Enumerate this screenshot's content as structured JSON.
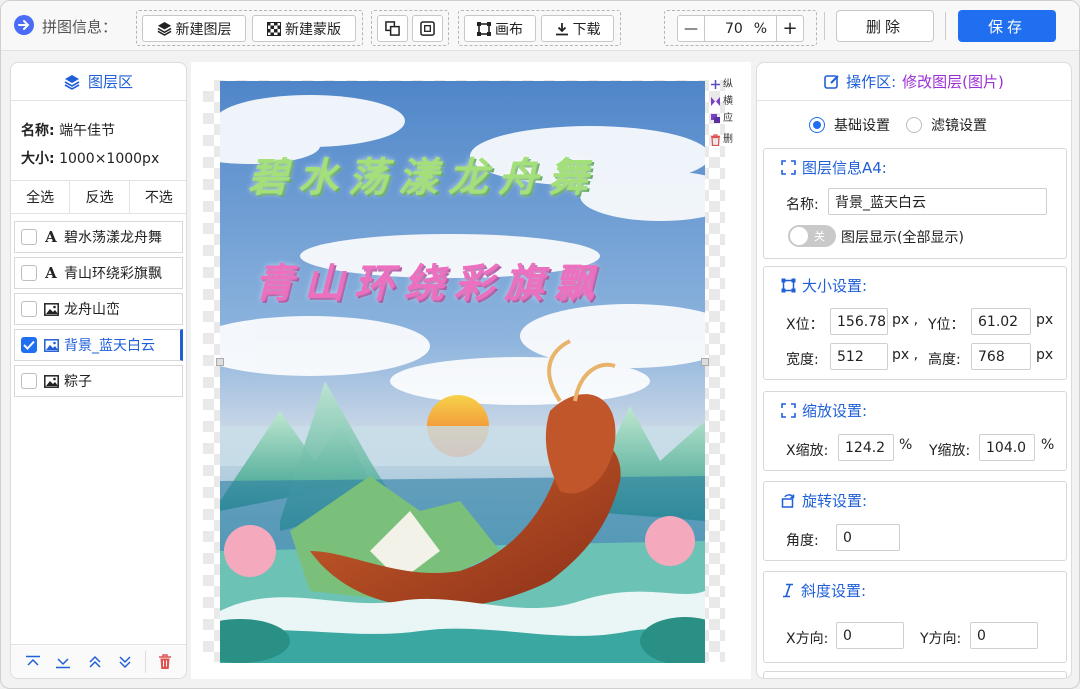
{
  "app": {
    "title": "拼图信息："
  },
  "toolbar": {
    "new_layer": "新建图层",
    "new_mask": "新建蒙版",
    "canvas": "画布",
    "download": "下载",
    "zoom_minus": "—",
    "zoom_value": "70",
    "zoom_unit": "%",
    "zoom_plus": "+",
    "delete": "删除",
    "save": "保存"
  },
  "left": {
    "title": "图层区",
    "name_label": "名称:",
    "name_value": "端午佳节",
    "size_label": "大小:",
    "size_value": "1000×1000px",
    "select_all": "全选",
    "invert": "反选",
    "select_none": "不选",
    "layers": [
      {
        "label": "碧水荡漾龙舟舞",
        "type": "text",
        "checked": false
      },
      {
        "label": "青山环绕彩旗飘",
        "type": "text",
        "checked": false
      },
      {
        "label": "龙舟山峦",
        "type": "image",
        "checked": false
      },
      {
        "label": "背景_蓝天白云",
        "type": "image",
        "checked": true
      },
      {
        "label": "粽子",
        "type": "image",
        "checked": false
      }
    ]
  },
  "canvas": {
    "poem_line1": "碧水荡漾龙舟舞",
    "poem_line2": "青山环绕彩旗飘",
    "menu": [
      "纵",
      "横",
      "应",
      "删"
    ]
  },
  "right": {
    "title": "操作区:",
    "subtitle": "修改图层(图片)",
    "tab_basic": "基础设置",
    "tab_filter": "滤镜设置",
    "info": {
      "title": "图层信息A4:",
      "name_label": "名称:",
      "name_value": "背景_蓝天白云",
      "toggle_text": "关",
      "display_label": "图层显示(全部显示)"
    },
    "size": {
      "title": "大小设置:",
      "x_label": "X位：",
      "x_value": "156.78",
      "y_label": "Y位：",
      "y_value": "61.02",
      "w_label": "宽度:",
      "w_value": "512",
      "h_label": "高度:",
      "h_value": "768",
      "unit": "px",
      "unit_comma": "px ,"
    },
    "scale": {
      "title": "缩放设置:",
      "x_label": "X缩放:",
      "x_value": "124.2",
      "y_label": "Y缩放:",
      "y_value": "104.0",
      "unit": "%"
    },
    "rotate": {
      "title": "旋转设置:",
      "angle_label": "角度:",
      "angle_value": "0"
    },
    "skew": {
      "title": "斜度设置:",
      "x_label": "X方向:",
      "x_value": "0",
      "y_label": "Y方向:",
      "y_value": "0"
    }
  },
  "colors": {
    "accent": "#1f6ff0",
    "accent_text": "#1f5fd8",
    "purple": "#9b2fd6"
  }
}
